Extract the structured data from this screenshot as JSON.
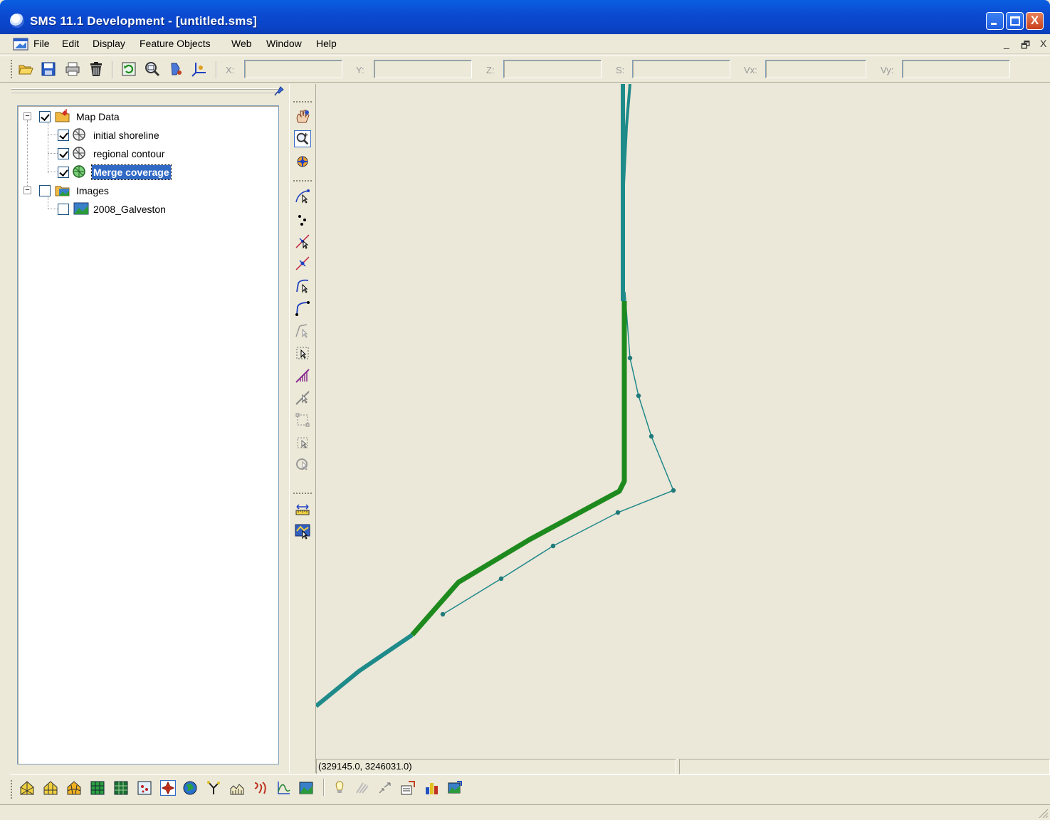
{
  "window": {
    "title": "SMS 11.1 Development - [untitled.sms]",
    "controls": {
      "minimize": "_",
      "maximize": "□",
      "close": "X"
    }
  },
  "menu": {
    "items": [
      "File",
      "Edit",
      "Display",
      "Feature Objects",
      "Web",
      "Window",
      "Help"
    ],
    "mdi_controls": [
      "_",
      "🗗",
      "X"
    ]
  },
  "toolbar": {
    "icons": [
      "open-icon",
      "save-icon",
      "print-icon",
      "delete-icon",
      "refresh-icon",
      "zoom-frame-icon",
      "display-options-icon",
      "axes-icon"
    ],
    "coords": [
      {
        "label": "X:",
        "value": ""
      },
      {
        "label": "Y:",
        "value": ""
      },
      {
        "label": "Z:",
        "value": ""
      },
      {
        "label": "S:",
        "value": ""
      },
      {
        "label": "Vx:",
        "value": ""
      },
      {
        "label": "Vy:",
        "value": ""
      }
    ]
  },
  "tree": {
    "items": [
      {
        "label": "Map Data",
        "checked": true,
        "expanded": true,
        "icon": "map-data-icon"
      },
      {
        "label": "initial shoreline",
        "checked": true,
        "icon": "coverage-icon"
      },
      {
        "label": "regional contour",
        "checked": true,
        "icon": "coverage-icon"
      },
      {
        "label": "Merge coverage",
        "checked": true,
        "icon": "coverage-active-icon",
        "selected": true
      },
      {
        "label": "Images",
        "checked": false,
        "expanded": true,
        "icon": "images-folder-icon"
      },
      {
        "label": "2008_Galveston",
        "checked": false,
        "icon": "image-icon"
      }
    ]
  },
  "palette": {
    "tools": [
      "pan-tool-icon",
      "zoom-tool-icon",
      "rotate-tool-icon",
      "select-feature-point-icon",
      "create-feature-point-icon",
      "select-feature-vertex-icon",
      "create-feature-vertex-icon",
      "select-feature-arc-icon",
      "create-feature-arc-icon",
      "select-arc-group-icon",
      "create-arc-group-icon",
      "select-polygon-icon",
      "create-polygon-icon",
      "select-feature-icon",
      "select-region-icon",
      "select-all-icon",
      "measure-tool-icon",
      "contour-tool-icon"
    ]
  },
  "status": {
    "coordinates": "(329145.0, 3246031.0)",
    "secondary": ""
  },
  "modules": {
    "icons": [
      "mesh-module-icon",
      "cartesian-grid-icon",
      "curvilinear-grid-icon",
      "scatter-module-icon",
      "map-module-icon",
      "gis-module-icon",
      "particle-module-icon",
      "quadtree-module-icon",
      "generic-model-icon",
      "annotation-icon",
      "hydrograph-icon",
      "profile-icon",
      "plot-icon",
      "image-module-icon"
    ]
  },
  "colors": {
    "accent": "#316ac5",
    "titlebar": "#0a43c6",
    "shoreline": "#1e8a1e",
    "contour": "#1f8a8a",
    "canvas": "#ebe7d9"
  }
}
